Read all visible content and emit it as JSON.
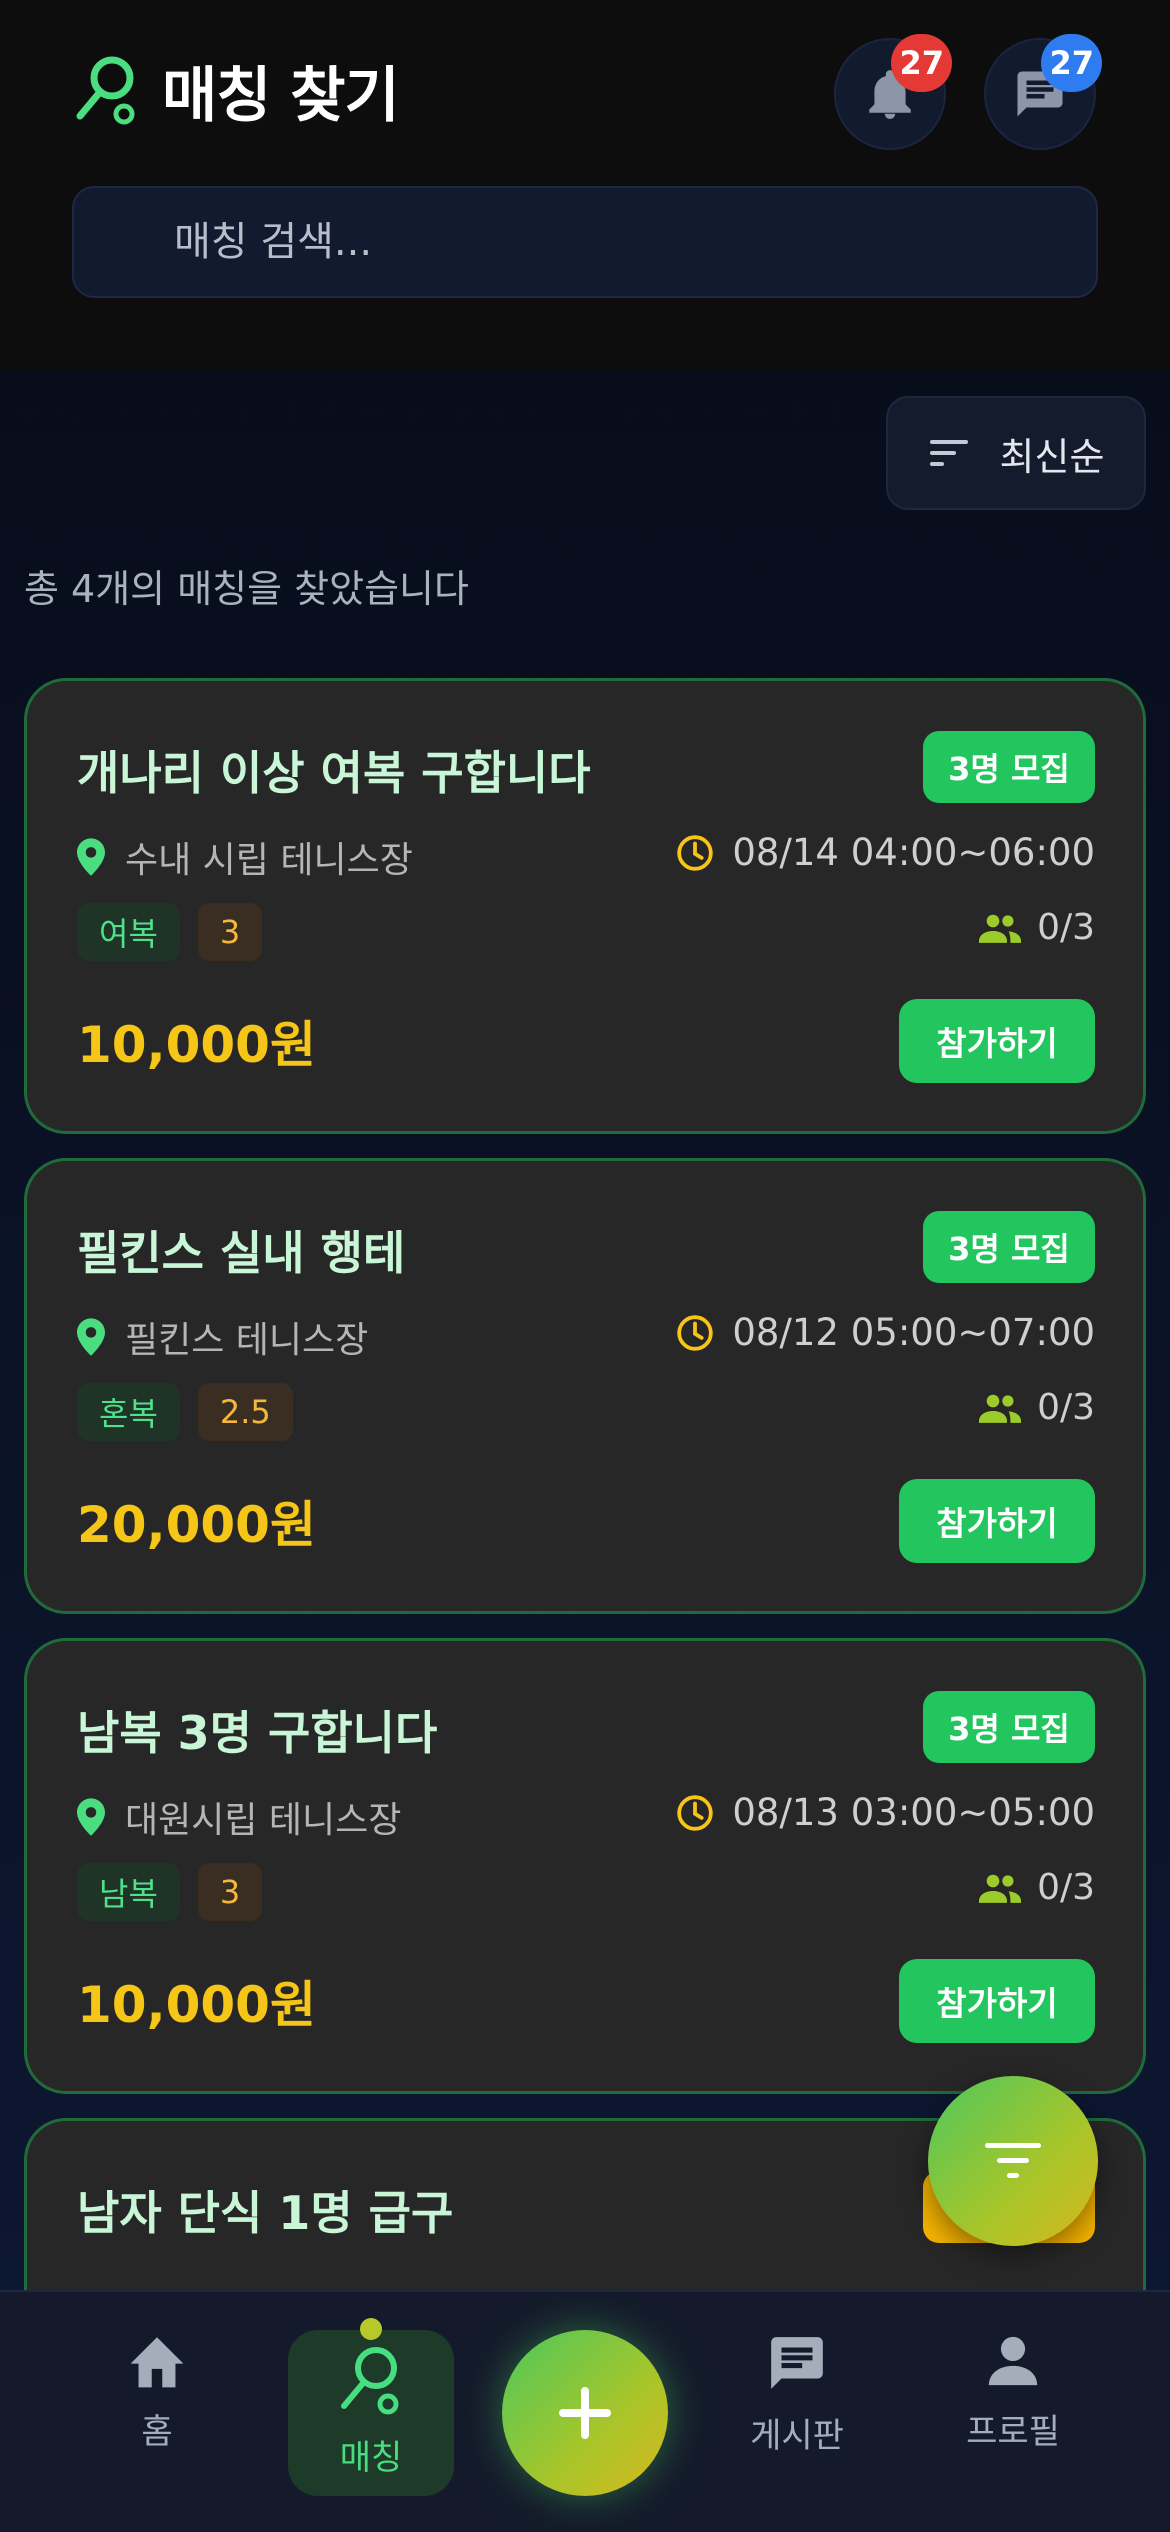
{
  "header": {
    "title": "매칭 찾기",
    "notifications_count": "27",
    "messages_count": "27"
  },
  "search": {
    "placeholder": "매칭 검색..."
  },
  "sort": {
    "label": "최신순"
  },
  "summary": "총 4개의 매칭을 찾았습니다",
  "matches": [
    {
      "title": "개나리 이상 여복 구합니다",
      "recruit": "3명 모집",
      "location": "수내 시립 테니스장",
      "time": "08/14 04:00~06:00",
      "type": "여복",
      "level": "3",
      "participants": "0/3",
      "price": "10,000원",
      "join_label": "참가하기"
    },
    {
      "title": "필킨스 실내 행테",
      "recruit": "3명 모집",
      "location": "필킨스 테니스장",
      "time": "08/12 05:00~07:00",
      "type": "혼복",
      "level": "2.5",
      "participants": "0/3",
      "price": "20,000원",
      "join_label": "참가하기"
    },
    {
      "title": "남복 3명 구합니다",
      "recruit": "3명 모집",
      "location": "대원시립 테니스장",
      "time": "08/13 03:00~05:00",
      "type": "남복",
      "level": "3",
      "participants": "0/3",
      "price": "10,000원",
      "join_label": "참가하기"
    },
    {
      "title": "남자 단식 1명 급구"
    }
  ],
  "nav": {
    "home": "홈",
    "match": "매칭",
    "board": "게시판",
    "profile": "프로필"
  },
  "colors": {
    "accent_green": "#22c55e",
    "price_yellow": "#f5c518",
    "card_bg": "#272727",
    "badge_red": "#e53935",
    "badge_blue": "#2f7bf0"
  },
  "icons": [
    "tennis-racket-icon",
    "bell-icon",
    "chat-icon",
    "sort-icon",
    "location-pin-icon",
    "clock-icon",
    "people-icon",
    "filter-icon",
    "home-icon",
    "plus-icon",
    "board-icon",
    "profile-icon"
  ]
}
